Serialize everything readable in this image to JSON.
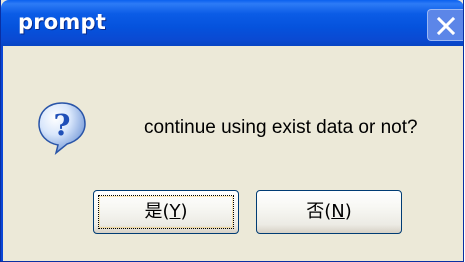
{
  "window": {
    "title": "prompt"
  },
  "message": "continue using exist data or not?",
  "icons": {
    "dialog": "question-icon",
    "close": "close-icon"
  },
  "buttons": {
    "yes": {
      "text": "是",
      "open": "(",
      "key": "Y",
      "close": ")"
    },
    "no": {
      "text": "否",
      "open": "(",
      "key": "N",
      "close": ")"
    }
  },
  "colors": {
    "titlebar": "#0552dc",
    "dialog_bg": "#ece9d8",
    "close_button": "#5c86e8",
    "icon_blue": "#1f5bc4"
  }
}
